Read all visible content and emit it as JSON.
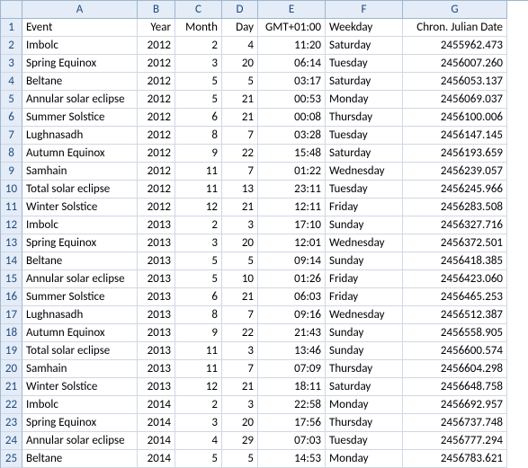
{
  "columns": [
    "A",
    "B",
    "C",
    "D",
    "E",
    "F",
    "G"
  ],
  "header_row": {
    "A": "Event",
    "B": "Year",
    "C": "Month",
    "D": "Day",
    "E": "GMT+01:00",
    "F": "Weekday",
    "G": "Chron. Julian Date"
  },
  "rows": [
    {
      "n": "1"
    },
    {
      "n": "2",
      "A": "Imbolc",
      "B": "2012",
      "C": "2",
      "D": "4",
      "E": "11:20",
      "F": "Saturday",
      "G": "2455962.473"
    },
    {
      "n": "3",
      "A": "Spring Equinox",
      "B": "2012",
      "C": "3",
      "D": "20",
      "E": "06:14",
      "F": "Tuesday",
      "G": "2456007.260"
    },
    {
      "n": "4",
      "A": "Beltane",
      "B": "2012",
      "C": "5",
      "D": "5",
      "E": "03:17",
      "F": "Saturday",
      "G": "2456053.137"
    },
    {
      "n": "5",
      "A": "Annular solar eclipse",
      "B": "2012",
      "C": "5",
      "D": "21",
      "E": "00:53",
      "F": "Monday",
      "G": "2456069.037"
    },
    {
      "n": "6",
      "A": "Summer Solstice",
      "B": "2012",
      "C": "6",
      "D": "21",
      "E": "00:08",
      "F": "Thursday",
      "G": "2456100.006"
    },
    {
      "n": "7",
      "A": "Lughnasadh",
      "B": "2012",
      "C": "8",
      "D": "7",
      "E": "03:28",
      "F": "Tuesday",
      "G": "2456147.145"
    },
    {
      "n": "8",
      "A": "Autumn Equinox",
      "B": "2012",
      "C": "9",
      "D": "22",
      "E": "15:48",
      "F": "Saturday",
      "G": "2456193.659"
    },
    {
      "n": "9",
      "A": "Samhain",
      "B": "2012",
      "C": "11",
      "D": "7",
      "E": "01:22",
      "F": "Wednesday",
      "G": "2456239.057"
    },
    {
      "n": "10",
      "A": "Total solar eclipse",
      "B": "2012",
      "C": "11",
      "D": "13",
      "E": "23:11",
      "F": "Tuesday",
      "G": "2456245.966"
    },
    {
      "n": "11",
      "A": "Winter Solstice",
      "B": "2012",
      "C": "12",
      "D": "21",
      "E": "12:11",
      "F": "Friday",
      "G": "2456283.508"
    },
    {
      "n": "12",
      "A": "Imbolc",
      "B": "2013",
      "C": "2",
      "D": "3",
      "E": "17:10",
      "F": "Sunday",
      "G": "2456327.716"
    },
    {
      "n": "13",
      "A": "Spring Equinox",
      "B": "2013",
      "C": "3",
      "D": "20",
      "E": "12:01",
      "F": "Wednesday",
      "G": "2456372.501"
    },
    {
      "n": "14",
      "A": "Beltane",
      "B": "2013",
      "C": "5",
      "D": "5",
      "E": "09:14",
      "F": "Sunday",
      "G": "2456418.385"
    },
    {
      "n": "15",
      "A": "Annular solar eclipse",
      "B": "2013",
      "C": "5",
      "D": "10",
      "E": "01:26",
      "F": "Friday",
      "G": "2456423.060"
    },
    {
      "n": "16",
      "A": "Summer Solstice",
      "B": "2013",
      "C": "6",
      "D": "21",
      "E": "06:03",
      "F": "Friday",
      "G": "2456465.253"
    },
    {
      "n": "17",
      "A": "Lughnasadh",
      "B": "2013",
      "C": "8",
      "D": "7",
      "E": "09:16",
      "F": "Wednesday",
      "G": "2456512.387"
    },
    {
      "n": "18",
      "A": "Autumn Equinox",
      "B": "2013",
      "C": "9",
      "D": "22",
      "E": "21:43",
      "F": "Sunday",
      "G": "2456558.905"
    },
    {
      "n": "19",
      "A": "Total solar eclipse",
      "B": "2013",
      "C": "11",
      "D": "3",
      "E": "13:46",
      "F": "Sunday",
      "G": "2456600.574"
    },
    {
      "n": "20",
      "A": "Samhain",
      "B": "2013",
      "C": "11",
      "D": "7",
      "E": "07:09",
      "F": "Thursday",
      "G": "2456604.298"
    },
    {
      "n": "21",
      "A": "Winter Solstice",
      "B": "2013",
      "C": "12",
      "D": "21",
      "E": "18:11",
      "F": "Saturday",
      "G": "2456648.758"
    },
    {
      "n": "22",
      "A": "Imbolc",
      "B": "2014",
      "C": "2",
      "D": "3",
      "E": "22:58",
      "F": "Monday",
      "G": "2456692.957"
    },
    {
      "n": "23",
      "A": "Spring Equinox",
      "B": "2014",
      "C": "3",
      "D": "20",
      "E": "17:56",
      "F": "Thursday",
      "G": "2456737.748"
    },
    {
      "n": "24",
      "A": "Annular solar eclipse",
      "B": "2014",
      "C": "4",
      "D": "29",
      "E": "07:03",
      "F": "Tuesday",
      "G": "2456777.294"
    },
    {
      "n": "25",
      "A": "Beltane",
      "B": "2014",
      "C": "5",
      "D": "5",
      "E": "14:53",
      "F": "Monday",
      "G": "2456783.621"
    }
  ]
}
